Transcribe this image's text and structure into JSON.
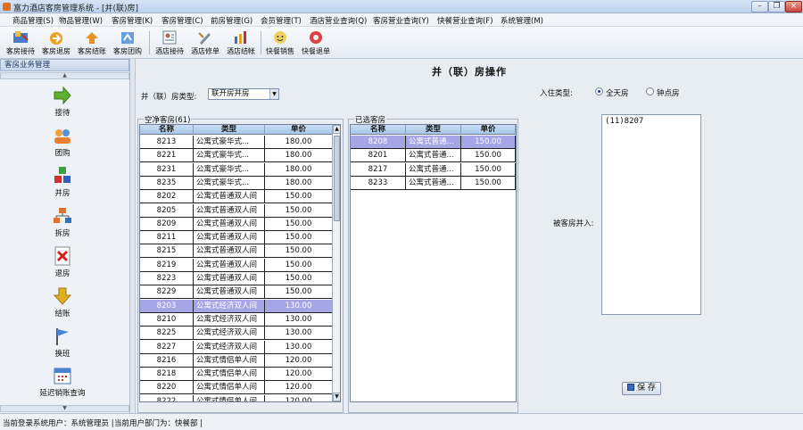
{
  "window": {
    "title": "富力酒店客房管理系统 - [并(联)房]",
    "minimize": "0",
    "restore": "1",
    "close": "×"
  },
  "menu": [
    "商品管理(S)",
    "物品管理(W)",
    "客房管理(K)",
    "客房管理(C)",
    "前房管理(G)",
    "会员管理(T)",
    "酒店营业查询(Q)",
    "客房营业查询(Y)",
    "快餐营业查询(F)",
    "系统管理(M)"
  ],
  "toolbar": [
    {
      "label": "客房接待",
      "icon": "reception-icon"
    },
    {
      "label": "客房退房",
      "icon": "checkout-icon"
    },
    {
      "label": "客房结账",
      "icon": "settle-icon"
    },
    {
      "label": "客房团购",
      "icon": "group-buy-icon"
    },
    {
      "label": "酒店接待",
      "icon": "hotel-reception-icon"
    },
    {
      "label": "酒店修单",
      "icon": "hotel-edit-icon"
    },
    {
      "label": "酒店结帐",
      "icon": "hotel-settle-icon"
    },
    {
      "label": "快餐销售",
      "icon": "fastfood-sale-icon"
    },
    {
      "label": "快餐退单",
      "icon": "fastfood-return-icon"
    }
  ],
  "sidebar": {
    "header": "客房业务管理",
    "items": [
      {
        "label": "接待",
        "icon": "arrow-right-icon"
      },
      {
        "label": "团购",
        "icon": "group-icon"
      },
      {
        "label": "并房",
        "icon": "merge-room-icon"
      },
      {
        "label": "拆房",
        "icon": "split-room-icon"
      },
      {
        "label": "退房",
        "icon": "cross-icon"
      },
      {
        "label": "结账",
        "icon": "arrow-down-icon"
      },
      {
        "label": "换班",
        "icon": "flag-icon"
      },
      {
        "label": "延迟销账查询",
        "icon": "calendar-icon"
      }
    ]
  },
  "page": {
    "title": "并（联）房操作",
    "room_type_label": "并（联）房类型:",
    "room_type_value": "联开房并房",
    "checkin_type_label": "入住类型:",
    "checkin_options": [
      {
        "label": "全天房",
        "checked": true
      },
      {
        "label": "钟点房",
        "checked": false
      }
    ],
    "free_rooms": {
      "title": "空净客房(61)",
      "columns": [
        "名称",
        "类型",
        "单价"
      ],
      "rows": [
        [
          "8213",
          "公寓式豪华式...",
          "180.00"
        ],
        [
          "8221",
          "公寓式豪华式...",
          "180.00"
        ],
        [
          "8231",
          "公寓式豪华式...",
          "180.00"
        ],
        [
          "8235",
          "公寓式豪华式...",
          "180.00"
        ],
        [
          "8202",
          "公寓式普通双人间",
          "150.00"
        ],
        [
          "8205",
          "公寓式普通双人间",
          "150.00"
        ],
        [
          "8209",
          "公寓式普通双人间",
          "150.00"
        ],
        [
          "8211",
          "公寓式普通双人间",
          "150.00"
        ],
        [
          "8215",
          "公寓式普通双人间",
          "150.00"
        ],
        [
          "8219",
          "公寓式普通双人间",
          "150.00"
        ],
        [
          "8223",
          "公寓式普通双人间",
          "150.00"
        ],
        [
          "8229",
          "公寓式普通双人间",
          "150.00"
        ],
        [
          "8203",
          "公寓式经济双人间",
          "130.00"
        ],
        [
          "8210",
          "公寓式经济双人间",
          "130.00"
        ],
        [
          "8225",
          "公寓式经济双人间",
          "130.00"
        ],
        [
          "8227",
          "公寓式经济双人间",
          "130.00"
        ],
        [
          "8216",
          "公寓式情侣单人间",
          "120.00"
        ],
        [
          "8218",
          "公寓式情侣单人间",
          "120.00"
        ],
        [
          "8220",
          "公寓式情侣单人间",
          "120.00"
        ],
        [
          "8222",
          "公寓式情侣单人间",
          "120.00"
        ]
      ],
      "selected_index": 12
    },
    "chosen_rooms": {
      "title": "已选客房",
      "columns": [
        "名称",
        "类型",
        "单价"
      ],
      "rows": [
        [
          "8208",
          "公寓式普通...",
          "150.00"
        ],
        [
          "8201",
          "公寓式普通...",
          "150.00"
        ],
        [
          "8217",
          "公寓式普通...",
          "150.00"
        ],
        [
          "8233",
          "公寓式普通...",
          "150.00"
        ]
      ],
      "selected_index": 0
    },
    "merged_label": "被客房并入:",
    "merged_value": "(11)8207",
    "save_label": "保 存"
  },
  "status": {
    "user": "当前登录系统用户：系统管理员 |",
    "dept": "当前用户部门为：快餐部 |"
  }
}
